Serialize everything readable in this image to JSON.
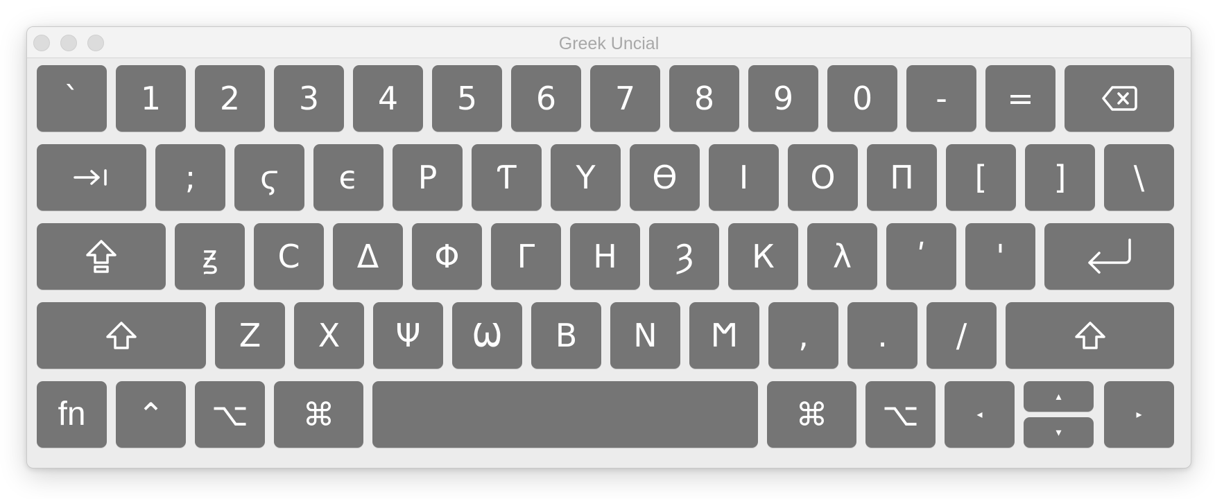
{
  "window": {
    "title": "Greek Uncial"
  },
  "keyboard": {
    "row1": [
      "`",
      "1",
      "2",
      "3",
      "4",
      "5",
      "6",
      "7",
      "8",
      "9",
      "0",
      "-",
      "="
    ],
    "row2": [
      ";",
      "ϛ",
      "ϵ",
      "Ρ",
      "Ƭ",
      "Υ",
      "Ѳ",
      "Ι",
      "Ο",
      "Π",
      "[",
      "]",
      "\\"
    ],
    "row3": [
      "ꙃ",
      "С",
      "ᐃ",
      "Φ",
      "Γ",
      "Н",
      "Ȝ",
      "К",
      "λ",
      "ʹ",
      "'"
    ],
    "row4": [
      "Ζ",
      "Χ",
      "Ψ",
      "Ѡ",
      "В",
      "N",
      "Ϻ",
      ",",
      ".",
      "/"
    ],
    "modifiers": {
      "fn": "fn",
      "control": "⌃",
      "option": "⌥",
      "command": "⌘",
      "arrow_left": "◂",
      "arrow_right": "▸",
      "arrow_up": "▴",
      "arrow_down": "▾"
    },
    "icons": {
      "delete": "delete-icon",
      "tab": "tab-icon",
      "caps_lock": "caps-lock-icon",
      "return": "return-icon",
      "shift": "shift-icon"
    }
  }
}
